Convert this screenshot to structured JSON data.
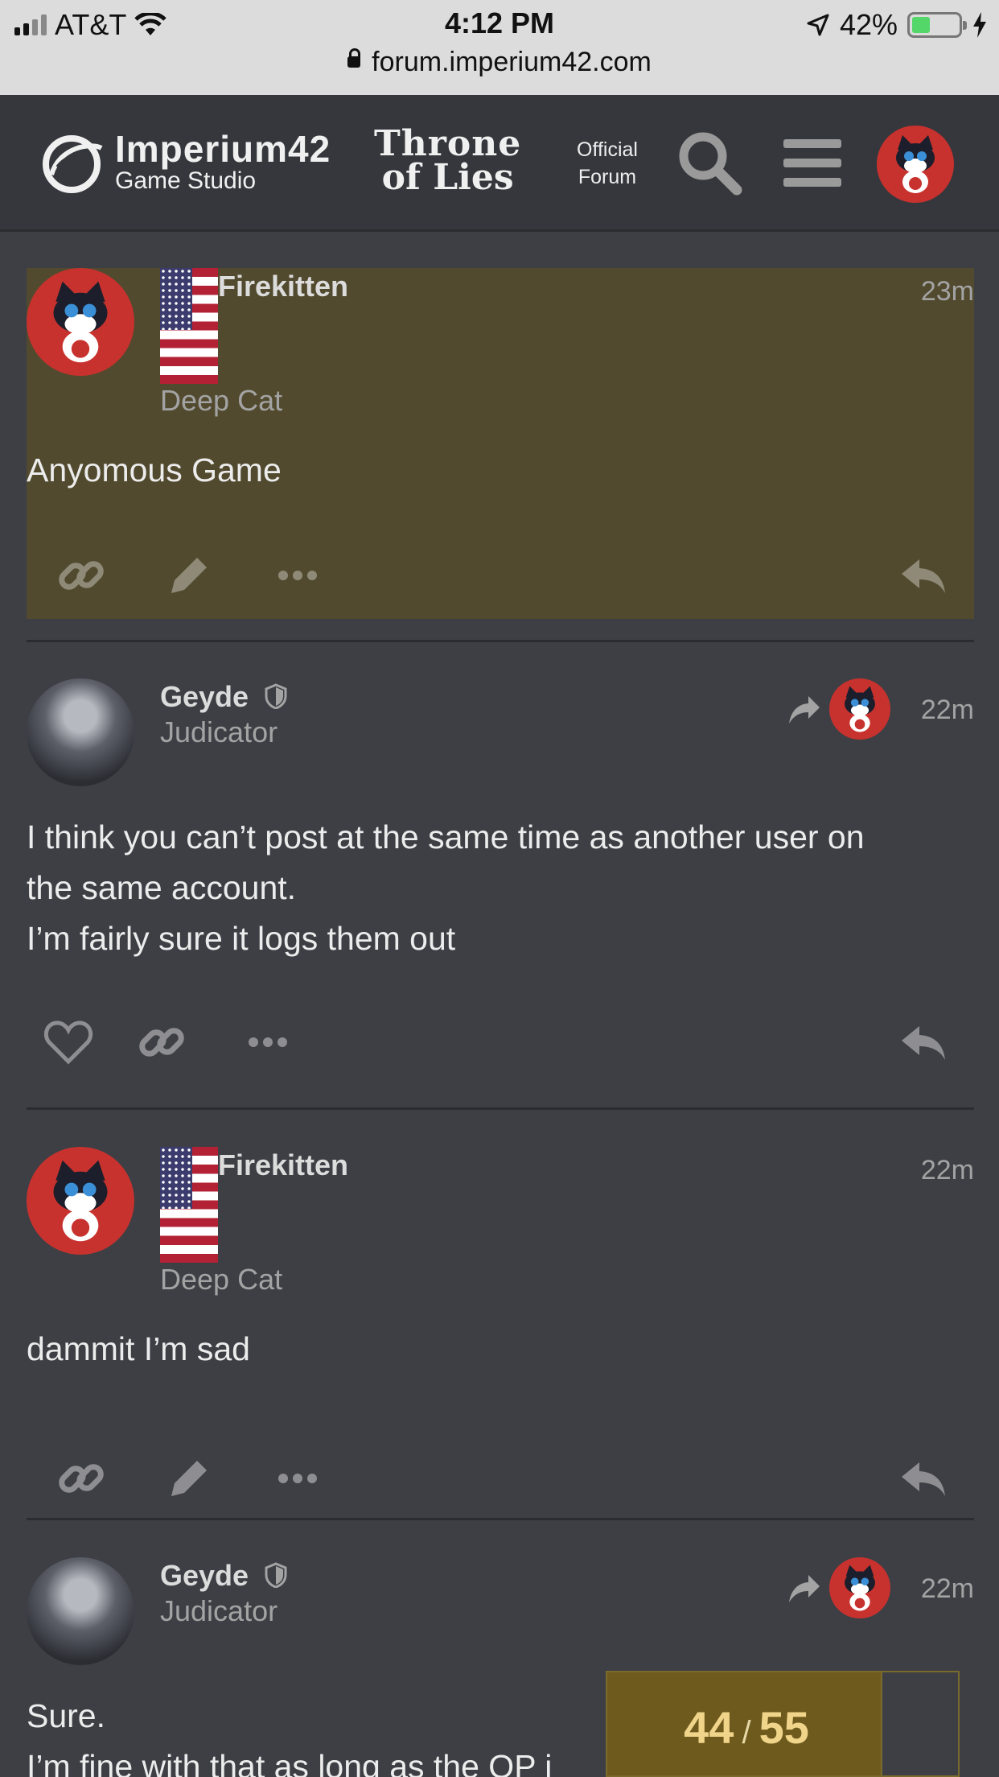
{
  "status_bar": {
    "carrier": "AT&T",
    "time": "4:12 PM",
    "battery": "42%",
    "battery_level": 0.42
  },
  "browser": {
    "url": "forum.imperium42.com"
  },
  "header": {
    "studio_name": "Imperium42",
    "studio_sub": "Game Studio",
    "game_line1": "Throne",
    "game_line2": "of Lies",
    "official_line1": "Official",
    "official_line2": "Forum"
  },
  "posts": [
    {
      "username": "Firekitten",
      "title": "Deep Cat",
      "time": "23m",
      "body": [
        "Anyomous Game"
      ],
      "highlighted": true
    },
    {
      "username": "Geyde",
      "title": "Judicator",
      "time": "22m",
      "body": [
        "I think you can’t post at the same time as another user on",
        "the same account.",
        "I’m fairly sure it logs them out"
      ]
    },
    {
      "username": "Firekitten",
      "title": "Deep Cat",
      "time": "22m",
      "body": [
        "dammit I’m sad"
      ]
    },
    {
      "username": "Geyde",
      "title": "Judicator",
      "time": "22m",
      "body": [
        "Sure.",
        "I’m fine with that as long as the OP i"
      ]
    }
  ],
  "timeline": {
    "current": "44",
    "separator": "/",
    "total": "55"
  },
  "colors": {
    "background": "#3d3f45",
    "highlight": "#524a2e",
    "accent": "#c8322e"
  }
}
